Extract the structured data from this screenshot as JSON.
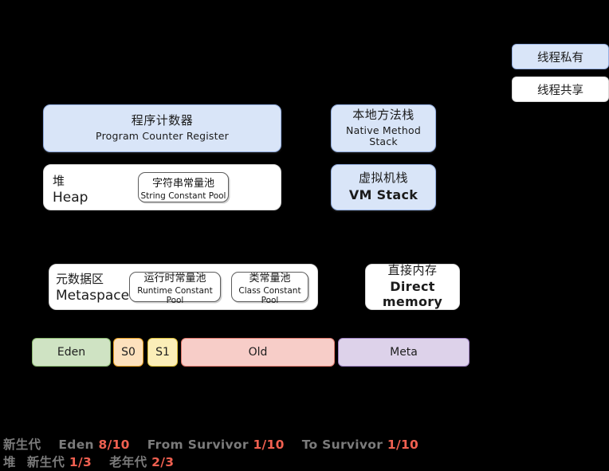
{
  "legend": {
    "private": "线程私有",
    "shared": "线程共享"
  },
  "regions": {
    "pc": {
      "cn": "程序计数器",
      "en": "Program Counter Register"
    },
    "native_stack": {
      "cn": "本地方法栈",
      "en": "Native Method Stack"
    },
    "vm_stack": {
      "cn": "虚拟机栈",
      "en": "VM Stack"
    },
    "heap": {
      "cn": "堆",
      "en": "Heap"
    },
    "string_pool": {
      "cn": "字符串常量池",
      "en": "String Constant Pool"
    },
    "metaspace": {
      "cn": "元数据区",
      "en": "Metaspace"
    },
    "runtime_pool": {
      "cn": "运行时常量池",
      "en": "Runtime Constant Pool"
    },
    "class_pool": {
      "cn": "类常量池",
      "en": "Class Constant Pool"
    },
    "direct_memory": {
      "cn": "直接内存",
      "en": "Direct memory"
    }
  },
  "memory_bar": {
    "segments": [
      {
        "label": "Eden",
        "fill": "#cfe3c3",
        "border": "#8bb870"
      },
      {
        "label": "S0",
        "fill": "#fde1bd",
        "border": "#e6a020"
      },
      {
        "label": "S1",
        "fill": "#fbeeb8",
        "border": "#dfc13a"
      },
      {
        "label": "Old",
        "fill": "#f7cdc8",
        "border": "#e0796c"
      },
      {
        "label": "Meta",
        "fill": "#ddd2ea",
        "border": "#a183c4"
      }
    ]
  },
  "footer": {
    "line1": {
      "label_young": "新生代",
      "eden_label": "Eden",
      "eden_ratio": "8/10",
      "from_label": "From Survivor",
      "from_ratio": "1/10",
      "to_label": "To Survivor",
      "to_ratio": "1/10"
    },
    "line2": {
      "heap_label": "堆",
      "young_label": "新生代",
      "young_ratio": "1/3",
      "old_label": "老年代",
      "old_ratio": "2/3"
    }
  },
  "colors": {
    "background": "#000000",
    "thread_private_fill": "#d9e5f8",
    "thread_private_border": "#93aee0",
    "thread_shared_fill": "#ffffff",
    "footer_label": "#7b7b7b",
    "footer_ratio": "#f06050"
  }
}
